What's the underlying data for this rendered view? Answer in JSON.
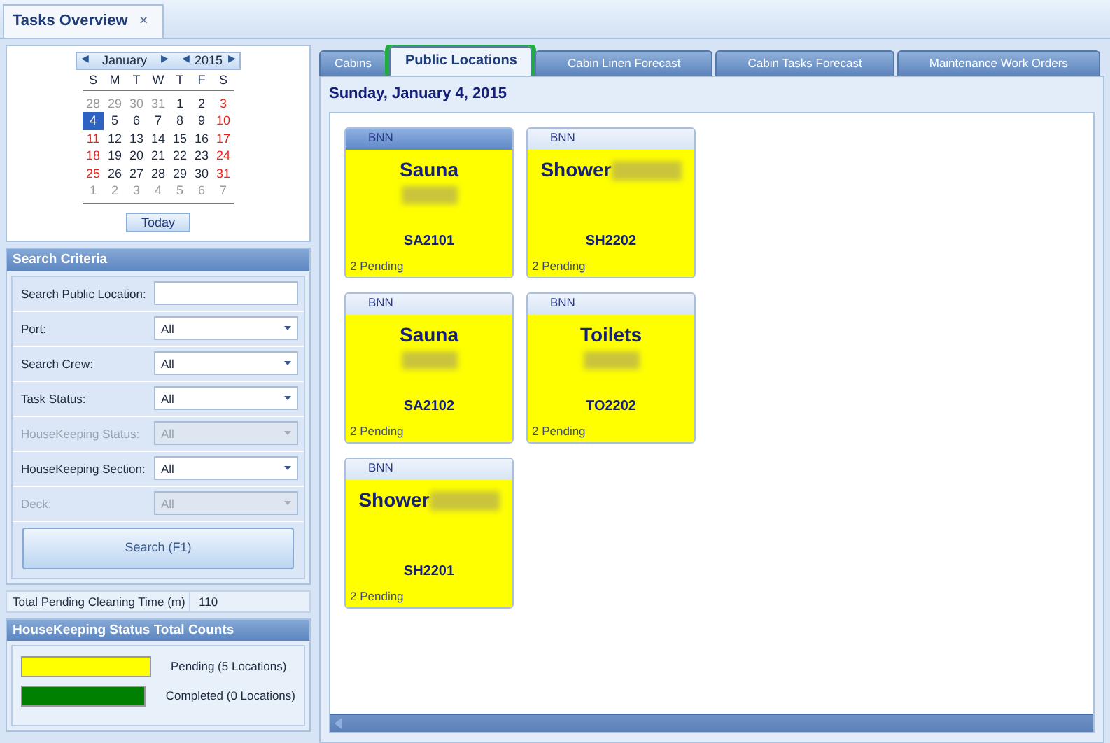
{
  "document_tab": {
    "title": "Tasks Overview",
    "close": "×"
  },
  "calendar": {
    "month": "January",
    "year": "2015",
    "prev": "◀",
    "next": "▶",
    "weekdays": [
      "S",
      "M",
      "T",
      "W",
      "T",
      "F",
      "S"
    ],
    "days": [
      {
        "label": "28",
        "other_month": true,
        "selected": false
      },
      {
        "label": "29",
        "other_month": true,
        "selected": false
      },
      {
        "label": "30",
        "other_month": true,
        "selected": false
      },
      {
        "label": "31",
        "other_month": true,
        "selected": false
      },
      {
        "label": "1",
        "other_month": false,
        "weekend": false,
        "selected": false
      },
      {
        "label": "2",
        "other_month": false,
        "weekend": false,
        "selected": false
      },
      {
        "label": "3",
        "other_month": false,
        "weekend": true,
        "selected": false
      },
      {
        "label": "4",
        "other_month": false,
        "weekend": true,
        "selected": true
      },
      {
        "label": "5",
        "other_month": false,
        "weekend": false,
        "selected": false
      },
      {
        "label": "6",
        "other_month": false,
        "weekend": false,
        "selected": false
      },
      {
        "label": "7",
        "other_month": false,
        "weekend": false,
        "selected": false
      },
      {
        "label": "8",
        "other_month": false,
        "weekend": false,
        "selected": false
      },
      {
        "label": "9",
        "other_month": false,
        "weekend": false,
        "selected": false
      },
      {
        "label": "10",
        "other_month": false,
        "weekend": true,
        "selected": false
      },
      {
        "label": "11",
        "other_month": false,
        "weekend": true,
        "selected": false
      },
      {
        "label": "12",
        "other_month": false,
        "weekend": false,
        "selected": false
      },
      {
        "label": "13",
        "other_month": false,
        "weekend": false,
        "selected": false
      },
      {
        "label": "14",
        "other_month": false,
        "weekend": false,
        "selected": false
      },
      {
        "label": "15",
        "other_month": false,
        "weekend": false,
        "selected": false
      },
      {
        "label": "16",
        "other_month": false,
        "weekend": false,
        "selected": false
      },
      {
        "label": "17",
        "other_month": false,
        "weekend": true,
        "selected": false
      },
      {
        "label": "18",
        "other_month": false,
        "weekend": true,
        "selected": false
      },
      {
        "label": "19",
        "other_month": false,
        "weekend": false,
        "selected": false
      },
      {
        "label": "20",
        "other_month": false,
        "weekend": false,
        "selected": false
      },
      {
        "label": "21",
        "other_month": false,
        "weekend": false,
        "selected": false
      },
      {
        "label": "22",
        "other_month": false,
        "weekend": false,
        "selected": false
      },
      {
        "label": "23",
        "other_month": false,
        "weekend": false,
        "selected": false
      },
      {
        "label": "24",
        "other_month": false,
        "weekend": true,
        "selected": false
      },
      {
        "label": "25",
        "other_month": false,
        "weekend": true,
        "selected": false
      },
      {
        "label": "26",
        "other_month": false,
        "weekend": false,
        "selected": false
      },
      {
        "label": "27",
        "other_month": false,
        "weekend": false,
        "selected": false
      },
      {
        "label": "28",
        "other_month": false,
        "weekend": false,
        "selected": false
      },
      {
        "label": "29",
        "other_month": false,
        "weekend": false,
        "selected": false
      },
      {
        "label": "30",
        "other_month": false,
        "weekend": false,
        "selected": false
      },
      {
        "label": "31",
        "other_month": false,
        "weekend": true,
        "selected": false
      },
      {
        "label": "1",
        "other_month": true,
        "selected": false
      },
      {
        "label": "2",
        "other_month": true,
        "selected": false
      },
      {
        "label": "3",
        "other_month": true,
        "selected": false
      },
      {
        "label": "4",
        "other_month": true,
        "selected": false
      },
      {
        "label": "5",
        "other_month": true,
        "selected": false
      },
      {
        "label": "6",
        "other_month": true,
        "selected": false
      },
      {
        "label": "7",
        "other_month": true,
        "selected": false
      }
    ],
    "today_button": "Today"
  },
  "search_criteria": {
    "title": "Search Criteria",
    "fields": [
      {
        "label": "Search Public Location:",
        "kind": "text",
        "disabled": false
      },
      {
        "label": "Port:",
        "kind": "select",
        "value": "All",
        "disabled": false
      },
      {
        "label": "Search Crew:",
        "kind": "select",
        "value": "All",
        "disabled": false
      },
      {
        "label": "Task Status:",
        "kind": "select",
        "value": "All",
        "disabled": false
      },
      {
        "label": "HouseKeeping Status:",
        "kind": "select",
        "value": "All",
        "disabled": true
      },
      {
        "label": "HouseKeeping Section:",
        "kind": "select",
        "value": "All",
        "disabled": false
      },
      {
        "label": "Deck:",
        "kind": "select",
        "value": "All",
        "disabled": true
      }
    ],
    "search_button": "Search (F1)"
  },
  "total_pending": {
    "label": "Total Pending Cleaning Time (m)",
    "value": "110"
  },
  "status_counts": {
    "title": "HouseKeeping Status Total Counts",
    "items": [
      {
        "color": "#ffff00",
        "label": "Pending (5 Locations)"
      },
      {
        "color": "#008000",
        "label": "Completed (0 Locations)"
      }
    ]
  },
  "tabs": [
    {
      "label": "Cabins",
      "selected": false,
      "highlighted": false
    },
    {
      "label": "Public Locations",
      "selected": true,
      "highlighted": true
    },
    {
      "label": "Cabin Linen Forecast",
      "selected": false,
      "highlighted": false
    },
    {
      "label": "Cabin Tasks Forecast",
      "selected": false,
      "highlighted": false
    },
    {
      "label": "Maintenance Work Orders",
      "selected": false,
      "highlighted": false
    }
  ],
  "date_heading": "Sunday, January 4, 2015",
  "locations": [
    {
      "header": "BNN",
      "name": "Sauna",
      "name_blurred": false,
      "blurred_line": true,
      "code": "SA2101",
      "status": "2 Pending",
      "selected": true
    },
    {
      "header": "BNN",
      "name": "Shower",
      "name_blurred": true,
      "blurred_line": false,
      "code": "SH2202",
      "status": "2 Pending",
      "selected": false
    },
    {
      "header": "BNN",
      "name": "Sauna",
      "name_blurred": false,
      "blurred_line": true,
      "code": "SA2102",
      "status": "2 Pending",
      "selected": false
    },
    {
      "header": "BNN",
      "name": "Toilets",
      "name_blurred": false,
      "blurred_line": true,
      "code": "TO2202",
      "status": "2 Pending",
      "selected": false
    },
    {
      "header": "BNN",
      "name": "Shower",
      "name_blurred": true,
      "blurred_line": false,
      "code": "SH2201",
      "status": "2 Pending",
      "selected": false
    }
  ]
}
